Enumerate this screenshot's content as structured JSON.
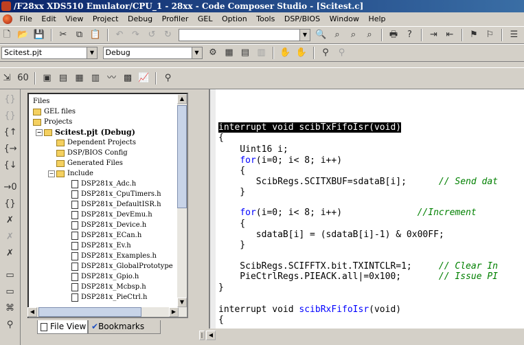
{
  "window": {
    "title": "/F28xx XDS510 Emulator/CPU_1 - 28xx - Code Composer Studio - [Scitest.c]"
  },
  "menu": [
    "File",
    "Edit",
    "View",
    "Project",
    "Debug",
    "Profiler",
    "GEL",
    "Option",
    "Tools",
    "DSP/BIOS",
    "Window",
    "Help"
  ],
  "project_combo": {
    "value": "Scitest.pjt"
  },
  "config_combo": {
    "value": "Debug"
  },
  "tree": {
    "root": "Files",
    "gel_files": "GEL files",
    "projects": "Projects",
    "project": "Scitest.pjt (Debug)",
    "dependent": "Dependent Projects",
    "dspbios": "DSP/BIOS Config",
    "generated": "Generated Files",
    "include": "Include",
    "files": [
      "DSP281x_Adc.h",
      "DSP281x_CpuTimers.h",
      "DSP281x_DefaultISR.h",
      "DSP281x_DevEmu.h",
      "DSP281x_Device.h",
      "DSP281x_ECan.h",
      "DSP281x_Ev.h",
      "DSP281x_Examples.h",
      "DSP281x_GlobalPrototype",
      "DSP281x_Gpio.h",
      "DSP281x_Mcbsp.h",
      "DSP281x_PieCtrl.h"
    ]
  },
  "tabs": {
    "file_view": "File View",
    "bookmarks": "Bookmarks"
  },
  "code": {
    "l1": "interrupt void scibTxFifoIsr(void)",
    "l2": "{",
    "l3": "    Uint16 i;",
    "l4_kw": "for",
    "l4_rest": "(i=0; i< 8; i++)",
    "l5": "    {",
    "l6": "       ScibRegs.SCITXBUF=sdataB[i];",
    "l6_cm": "// Send dat",
    "l7": "    }",
    "l8_kw": "for",
    "l8_rest": "(i=0; i< 8; i++)",
    "l8_cm": "//Increment",
    "l9": "    {",
    "l10": "       sdataB[i] = (sdataB[i]-1) & 0x00FF;",
    "l11": "    }",
    "l12": "    ScibRegs.SCIFFTX.bit.TXINTCLR=1;",
    "l12_cm": "// Clear In",
    "l13": "    PieCtrlRegs.PIEACK.all|=0x100;",
    "l13_cm": "// Issue PI",
    "l14": "}",
    "l15_a": "interrupt void ",
    "l15_fn": "scibRxFifoIsr",
    "l15_b": "(void)",
    "l16": "{"
  }
}
